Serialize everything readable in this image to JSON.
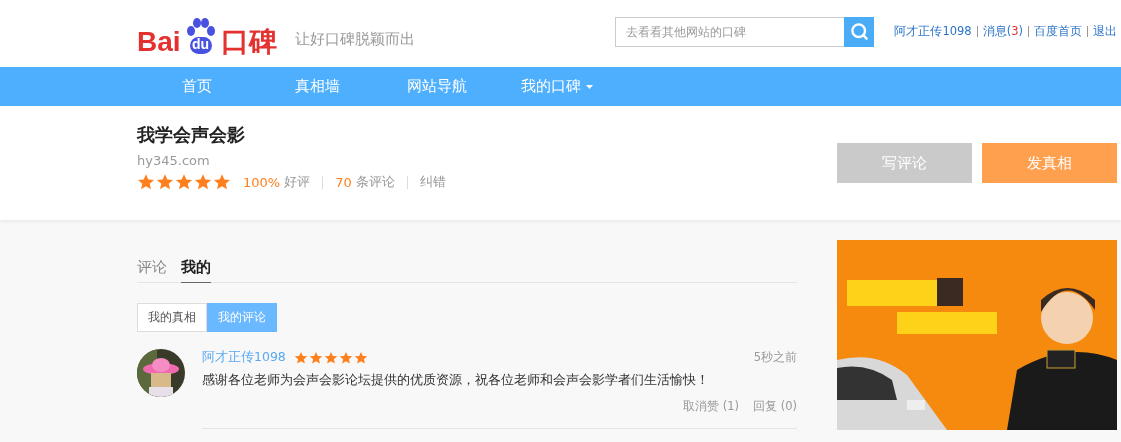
{
  "header": {
    "logo": {
      "left": "Bai",
      "paw": "du",
      "right": "口碑"
    },
    "slogan": "让好口碑脱颖而出",
    "search": {
      "placeholder": "去看看其他网站的口碑"
    },
    "user_links": [
      {
        "kind": "user",
        "label": "阿才正传1098"
      },
      {
        "kind": "messages",
        "label": "消息(",
        "count": "3",
        "close": ")"
      },
      {
        "kind": "link",
        "label": "百度首页"
      },
      {
        "kind": "link",
        "label": "退出"
      }
    ]
  },
  "nav": [
    {
      "label": "首页",
      "dropdown": false
    },
    {
      "label": "真相墙",
      "dropdown": false
    },
    {
      "label": "网站导航",
      "dropdown": false
    },
    {
      "label": "我的口碑",
      "dropdown": true
    }
  ],
  "site": {
    "title": "我学会声会影",
    "url": "hy345.com",
    "stars": 5,
    "rating": "100%",
    "rating_label": "好评",
    "count": "70",
    "count_label": "条评论",
    "report": "纠错",
    "buttons": [
      {
        "kind": "gray",
        "label": "写评论"
      },
      {
        "kind": "orange",
        "label": "发真相"
      }
    ]
  },
  "tabs": [
    {
      "label": "评论",
      "selected": false
    },
    {
      "label": "我的",
      "selected": true
    }
  ],
  "subtabs": [
    {
      "label": "我的真相",
      "selected": false
    },
    {
      "label": "我的评论",
      "selected": true
    }
  ],
  "comments": [
    {
      "user": "阿才正传1098",
      "stars": 5,
      "time": "5秒之前",
      "text": "感谢各位老师为会声会影论坛提供的优质资源，祝各位老师和会声会影学者们生活愉快！",
      "actions": [
        "取消赞 (1)",
        "回复 (0)"
      ]
    }
  ]
}
